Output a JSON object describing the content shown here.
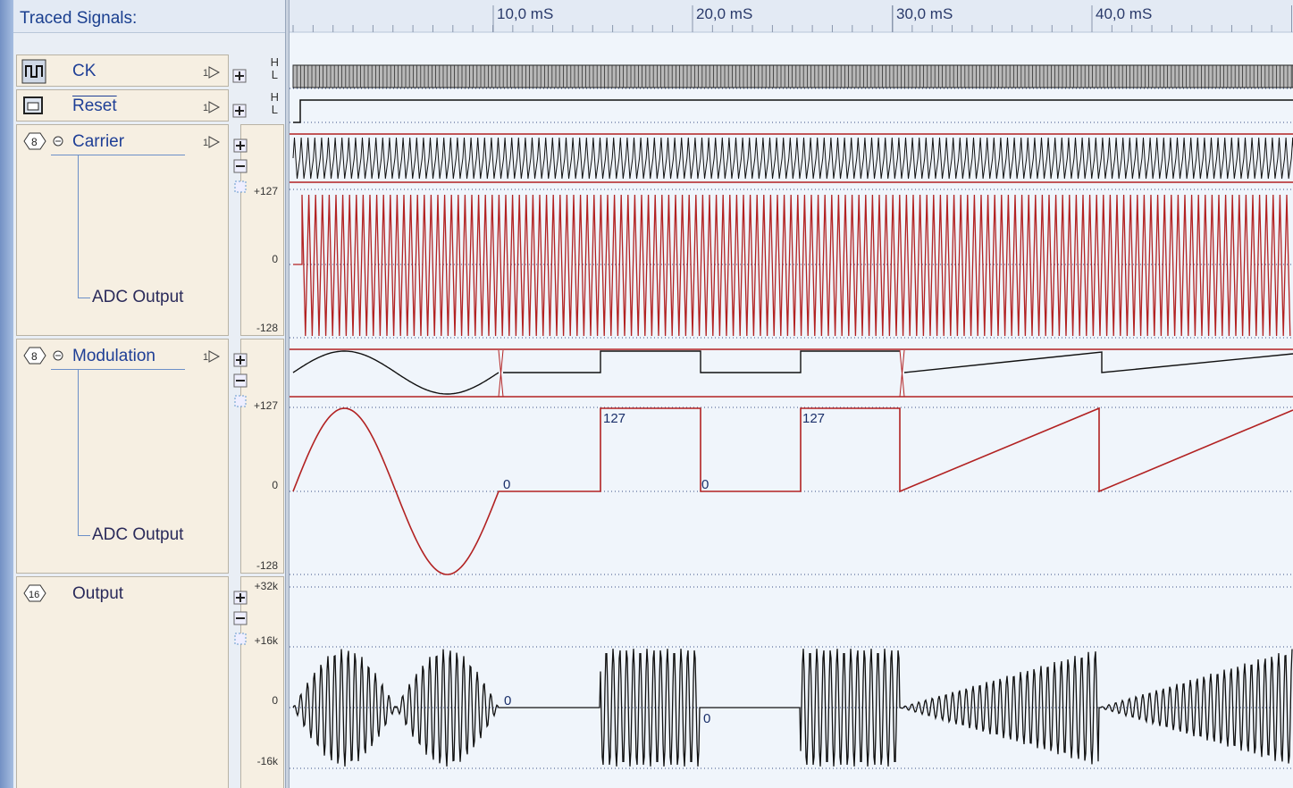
{
  "header": {
    "title": "Traced Signals:"
  },
  "ruler": {
    "labels": [
      "10,0 mS",
      "20,0 mS",
      "30,0 mS",
      "40,0 mS"
    ]
  },
  "signals": {
    "ck": {
      "name": "CK",
      "hi": "H",
      "lo": "L",
      "icon": "clock-square-wave-icon"
    },
    "reset": {
      "name": "Reset",
      "hi": "H",
      "lo": "L",
      "icon": "reset-input-icon"
    },
    "carrier": {
      "name": "Carrier",
      "child": "ADC Output",
      "bus_icon": "8",
      "scale": [
        "+127",
        "0",
        "-128"
      ]
    },
    "modulation": {
      "name": "Modulation",
      "child": "ADC Output",
      "bus_icon": "8",
      "scale": [
        "+127",
        "0",
        "-128"
      ],
      "value_labels": [
        "0",
        "127",
        "0",
        "127"
      ]
    },
    "output": {
      "name": "Output",
      "bus_icon": "16",
      "scale": [
        "+32k",
        "+16k",
        "0",
        "-16k"
      ],
      "value_labels": [
        "0",
        "0"
      ]
    }
  },
  "colors": {
    "waveform_red": "#b22222",
    "waveform_black": "#111111",
    "label_blue": "#1f3f96"
  }
}
